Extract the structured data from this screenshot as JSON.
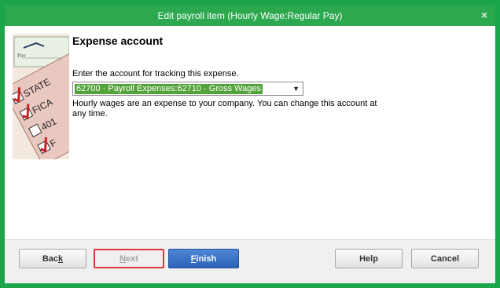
{
  "window": {
    "title": "Edit payroll item (Hourly Wage:Regular Pay)",
    "close_symbol": "×"
  },
  "main": {
    "heading": "Expense account",
    "instruction": "Enter the account for tracking this expense.",
    "account_select": {
      "selected": "62700 · Payroll Expenses:62710 · Gross Wages"
    },
    "help_text": "Hourly wages are an expense to your company. You can change this account at any time."
  },
  "illustration": {
    "check_text": "Pay",
    "labels": [
      "STATE",
      "FICA",
      "401",
      "F"
    ]
  },
  "footer": {
    "back_prefix": "Bac",
    "back_key": "k",
    "next_prefix": "",
    "next_key": "N",
    "next_suffix": "ext",
    "finish_prefix": "",
    "finish_key": "F",
    "finish_suffix": "inish",
    "help_label": "Help",
    "cancel_label": "Cancel"
  },
  "colors": {
    "frame": "#1aa54b",
    "titlebar": "#2ca84f",
    "selection": "#53a33a",
    "finish_button": "#2b63b8",
    "highlight": "#e0383a"
  }
}
